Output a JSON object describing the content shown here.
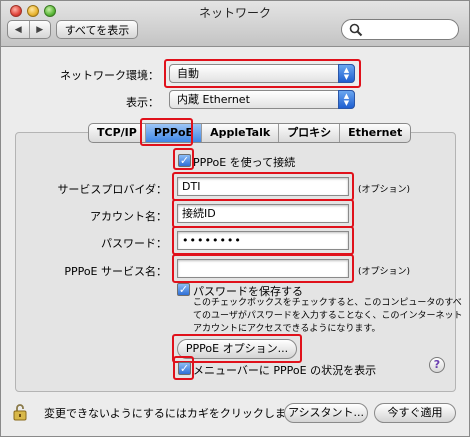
{
  "window": {
    "title": "ネットワーク"
  },
  "toolbar": {
    "back_glyph": "◀",
    "forward_glyph": "▶",
    "show_all_label": "すべてを表示",
    "search_value": "",
    "search_placeholder": ""
  },
  "location": {
    "label": "ネットワーク環境：",
    "value": "自動"
  },
  "show": {
    "label": "表示：",
    "value": "内蔵 Ethernet"
  },
  "tabs": [
    {
      "label": "TCP/IP",
      "active": false
    },
    {
      "label": "PPPoE",
      "active": true
    },
    {
      "label": "AppleTalk",
      "active": false
    },
    {
      "label": "プロキシ",
      "active": false
    },
    {
      "label": "Ethernet",
      "active": false
    }
  ],
  "pppoe": {
    "use_pppoe_label": "PPPoE を使って接続",
    "use_pppoe_checked": true,
    "service_provider": {
      "label": "サービスプロバイダ：",
      "value": "DTI",
      "hint": "(オプション)"
    },
    "account_name": {
      "label": "アカウント名：",
      "value": "接続ID"
    },
    "password": {
      "label": "パスワード：",
      "value": "••••••••"
    },
    "service_name": {
      "label": "PPPoE サービス名：",
      "value": "",
      "hint": "(オプション)"
    },
    "save_password_label": "パスワードを保存する",
    "save_password_checked": true,
    "save_password_description": "このチェックボックスをチェックすると、このコンピュータのすべてのユーザがパスワードを入力することなく、このインターネットアカウントにアクセスできるようになります。",
    "options_button_label": "PPPoE オプション...",
    "menubar_status_label": "メニューバーに PPPoE の状況を表示",
    "menubar_status_checked": true,
    "help_glyph": "?"
  },
  "footer": {
    "lock_text": "変更できないようにするにはカギをクリックします。",
    "assistant_label": "アシスタント...",
    "apply_label": "今すぐ適用"
  },
  "colors": {
    "highlight_red": "#e0111b",
    "accent_blue": "#3f86e6"
  }
}
